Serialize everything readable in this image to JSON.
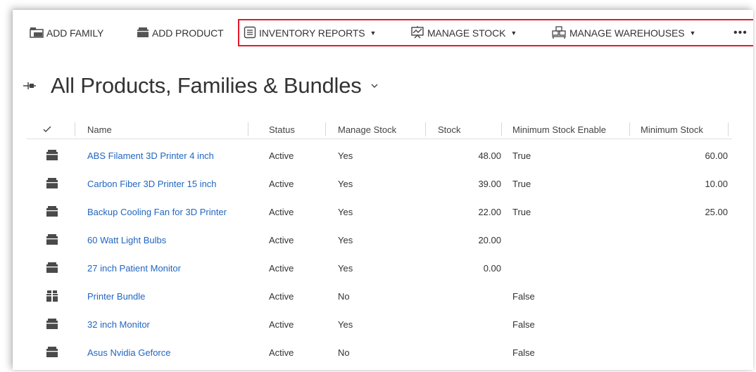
{
  "toolbar": {
    "add_family": "ADD FAMILY",
    "add_product": "ADD PRODUCT",
    "inventory_reports": "INVENTORY REPORTS",
    "manage_stock": "MANAGE STOCK",
    "manage_warehouses": "MANAGE WAREHOUSES",
    "more": "•••"
  },
  "view": {
    "title": "All Products, Families & Bundles"
  },
  "grid": {
    "columns": {
      "name": "Name",
      "status": "Status",
      "manage_stock": "Manage Stock",
      "stock": "Stock",
      "min_stock_enable": "Minimum Stock Enable",
      "min_stock": "Minimum Stock"
    },
    "rows": [
      {
        "icon": "product-icon",
        "name": "ABS Filament 3D Printer 4 inch",
        "status": "Active",
        "manage_stock": "Yes",
        "stock": "48.00",
        "min_stock_enable": "True",
        "min_stock": "60.00"
      },
      {
        "icon": "product-icon",
        "name": "Carbon Fiber 3D Printer 15 inch",
        "status": "Active",
        "manage_stock": "Yes",
        "stock": "39.00",
        "min_stock_enable": "True",
        "min_stock": "10.00"
      },
      {
        "icon": "product-icon",
        "name": "Backup Cooling Fan for 3D Printer",
        "status": "Active",
        "manage_stock": "Yes",
        "stock": "22.00",
        "min_stock_enable": "True",
        "min_stock": "25.00"
      },
      {
        "icon": "product-icon",
        "name": "60 Watt Light Bulbs",
        "status": "Active",
        "manage_stock": "Yes",
        "stock": "20.00",
        "min_stock_enable": "",
        "min_stock": ""
      },
      {
        "icon": "product-icon",
        "name": "27 inch Patient Monitor",
        "status": "Active",
        "manage_stock": "Yes",
        "stock": "0.00",
        "min_stock_enable": "",
        "min_stock": ""
      },
      {
        "icon": "bundle-icon",
        "name": "Printer Bundle",
        "status": "Active",
        "manage_stock": "No",
        "stock": "",
        "min_stock_enable": "False",
        "min_stock": ""
      },
      {
        "icon": "product-icon",
        "name": "32 inch Monitor",
        "status": "Active",
        "manage_stock": "Yes",
        "stock": "",
        "min_stock_enable": "False",
        "min_stock": ""
      },
      {
        "icon": "product-icon",
        "name": "Asus Nvidia Geforce",
        "status": "Active",
        "manage_stock": "No",
        "stock": "",
        "min_stock_enable": "False",
        "min_stock": ""
      }
    ]
  },
  "colors": {
    "link": "#2266c0",
    "highlight": "#e3192b"
  }
}
